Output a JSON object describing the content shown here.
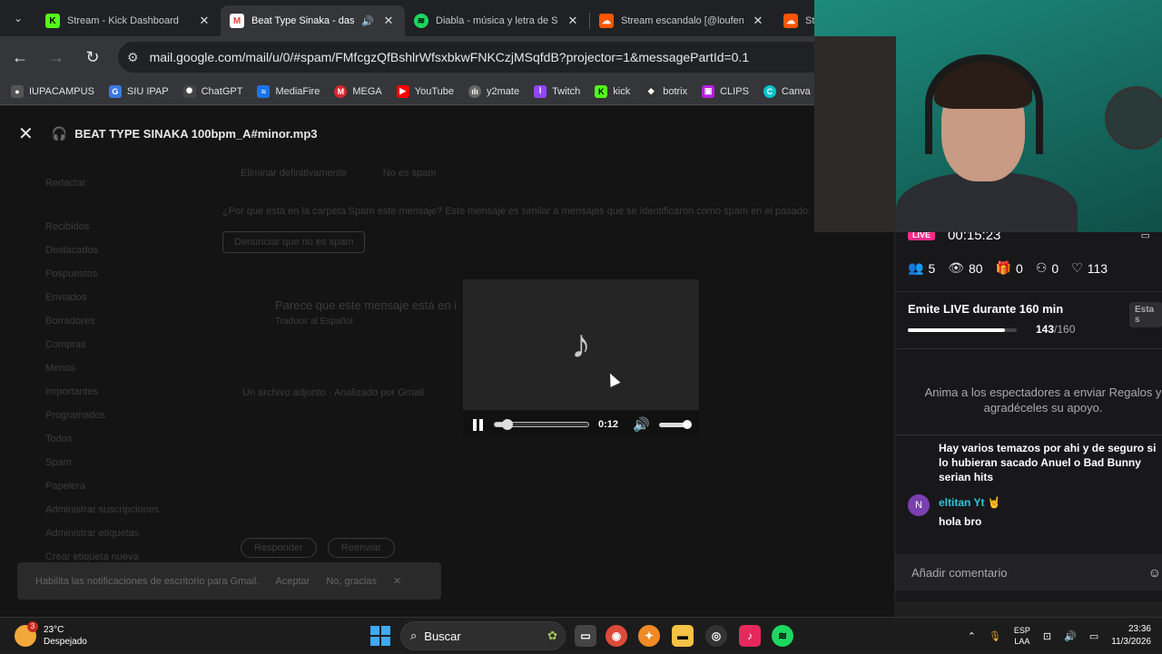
{
  "browser": {
    "tabs": [
      {
        "title": "Stream - Kick Dashboard",
        "icon": "kick-icon",
        "color": "#53fc18",
        "active": false
      },
      {
        "title": "Beat Type Sinaka - dastin",
        "icon": "gmail-icon",
        "color": "#ea4335",
        "active": true,
        "audio": true
      },
      {
        "title": "Diabla - música y letra de Sai",
        "icon": "spotify-icon",
        "color": "#1ed760",
        "active": false
      },
      {
        "title": "Stream escandalo [@loufend]",
        "icon": "soundcloud-icon",
        "color": "#ff5500",
        "active": false
      },
      {
        "title": "St",
        "icon": "soundcloud-icon",
        "color": "#ff5500",
        "active": false
      }
    ],
    "url": "mail.google.com/mail/u/0/#spam/FMfcgzQfBshlrWfsxbkwFNKCzjMSqfdB?projector=1&messagePartId=0.1",
    "bookmarks": [
      {
        "label": "IUPACAMPUS",
        "color": "#555555"
      },
      {
        "label": "SIU IPAP",
        "color": "#3b78e7"
      },
      {
        "label": "ChatGPT",
        "color": "#444444"
      },
      {
        "label": "MediaFire",
        "color": "#1b74e8"
      },
      {
        "label": "MEGA",
        "color": "#d9272e"
      },
      {
        "label": "YouTube",
        "color": "#ff0000"
      },
      {
        "label": "y2mate",
        "color": "#666666"
      },
      {
        "label": "Twitch",
        "color": "#9146ff"
      },
      {
        "label": "kick",
        "color": "#53fc18"
      },
      {
        "label": "botrix",
        "color": "#333333"
      },
      {
        "label": "CLIPS",
        "color": "#b620e0"
      },
      {
        "label": "Canva",
        "color": "#00c4cc"
      }
    ]
  },
  "viewer": {
    "filename": "BEAT TYPE SINAKA 100bpm_A#minor.mp3",
    "player": {
      "time": "0:12",
      "progress": 0.14,
      "volume": 1.0
    }
  },
  "gmail_bg": {
    "nav": [
      "Redactar",
      "Recibidos",
      "Destacados",
      "Pospuestos",
      "Enviados",
      "Borradores",
      "Compras",
      "Menos",
      "Importantes",
      "Programados",
      "Todos",
      "Spam",
      "Papelera",
      "Administrar suscripciones",
      "Administrar etiquetas",
      "Crear etiqueta nueva"
    ],
    "header_actions": [
      "Eliminar definitivamente",
      "No es spam"
    ],
    "spam_notice": "¿Por qué está en la carpeta Spam este mensaje? Este mensaje es similar a mensajes que se identificaron como spam en el pasado.",
    "report_button": "Denunciar que no es spam",
    "warning_title": "Parece que este mensaje está en i",
    "warning_sub": "Traducir al Español",
    "attachment": "Un archivo adjunto · Analizado por Gmail",
    "reply": "Responder",
    "forward": "Reenviar",
    "toast": {
      "text": "Habilita las notificaciones de escritorio para Gmail.",
      "ok": "Aceptar",
      "no": "No, gracias"
    }
  },
  "live": {
    "badge": "LIVE",
    "time": "00:15:23",
    "stats": [
      {
        "icon": "users-icon",
        "glyph": "👥",
        "value": "5"
      },
      {
        "icon": "eye-icon",
        "glyph": "👁",
        "value": "80"
      },
      {
        "icon": "gift-icon",
        "glyph": "🎁",
        "value": "0"
      },
      {
        "icon": "follow-icon",
        "glyph": "⚇",
        "value": "0"
      },
      {
        "icon": "heart-icon",
        "glyph": "♡",
        "value": "113"
      }
    ],
    "goal": {
      "title": "Emite LIVE durante 160 min",
      "badge": "Esta s",
      "current": "143",
      "total": "/160",
      "progress": 0.894
    },
    "prompt": "Anima a los espectadores a enviar Regalos y agradéceles su apoyo.",
    "messages": [
      {
        "text": "Hay varios temazos por ahi y de seguro si lo hubieran sacado Anuel o Bad Bunny serian hits"
      },
      {
        "avatar": "N",
        "user": "eltitan Yt",
        "text": "hola bro"
      }
    ],
    "comment_placeholder": "Añadir comentario"
  },
  "taskbar": {
    "weather": {
      "temp": "23°C",
      "desc": "Despejado",
      "badge": "3"
    },
    "search": "Buscar",
    "lang": "ESP",
    "layout": "LAA",
    "time": "23:36",
    "date": "11/3/2026"
  }
}
